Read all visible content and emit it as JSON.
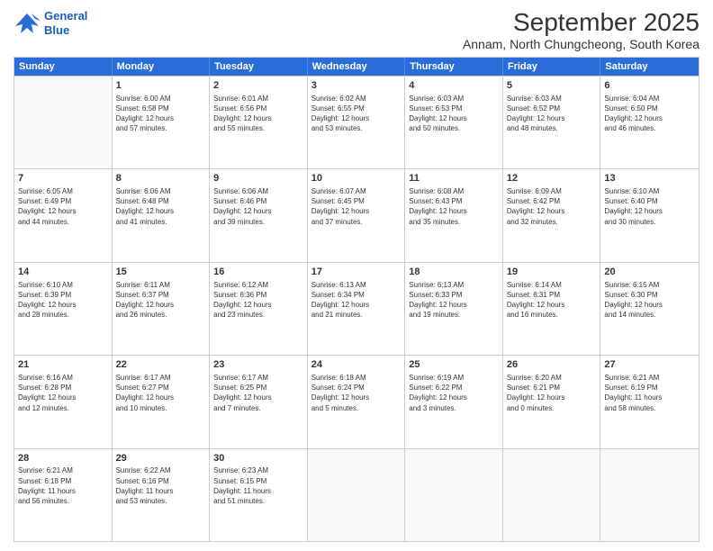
{
  "logo": {
    "line1": "General",
    "line2": "Blue"
  },
  "title": "September 2025",
  "location": "Annam, North Chungcheong, South Korea",
  "days_of_week": [
    "Sunday",
    "Monday",
    "Tuesday",
    "Wednesday",
    "Thursday",
    "Friday",
    "Saturday"
  ],
  "weeks": [
    [
      {
        "day": "",
        "content": ""
      },
      {
        "day": "1",
        "content": "Sunrise: 6:00 AM\nSunset: 6:58 PM\nDaylight: 12 hours\nand 57 minutes."
      },
      {
        "day": "2",
        "content": "Sunrise: 6:01 AM\nSunset: 6:56 PM\nDaylight: 12 hours\nand 55 minutes."
      },
      {
        "day": "3",
        "content": "Sunrise: 6:02 AM\nSunset: 6:55 PM\nDaylight: 12 hours\nand 53 minutes."
      },
      {
        "day": "4",
        "content": "Sunrise: 6:03 AM\nSunset: 6:53 PM\nDaylight: 12 hours\nand 50 minutes."
      },
      {
        "day": "5",
        "content": "Sunrise: 6:03 AM\nSunset: 6:52 PM\nDaylight: 12 hours\nand 48 minutes."
      },
      {
        "day": "6",
        "content": "Sunrise: 6:04 AM\nSunset: 6:50 PM\nDaylight: 12 hours\nand 46 minutes."
      }
    ],
    [
      {
        "day": "7",
        "content": "Sunrise: 6:05 AM\nSunset: 6:49 PM\nDaylight: 12 hours\nand 44 minutes."
      },
      {
        "day": "8",
        "content": "Sunrise: 6:06 AM\nSunset: 6:48 PM\nDaylight: 12 hours\nand 41 minutes."
      },
      {
        "day": "9",
        "content": "Sunrise: 6:06 AM\nSunset: 6:46 PM\nDaylight: 12 hours\nand 39 minutes."
      },
      {
        "day": "10",
        "content": "Sunrise: 6:07 AM\nSunset: 6:45 PM\nDaylight: 12 hours\nand 37 minutes."
      },
      {
        "day": "11",
        "content": "Sunrise: 6:08 AM\nSunset: 6:43 PM\nDaylight: 12 hours\nand 35 minutes."
      },
      {
        "day": "12",
        "content": "Sunrise: 6:09 AM\nSunset: 6:42 PM\nDaylight: 12 hours\nand 32 minutes."
      },
      {
        "day": "13",
        "content": "Sunrise: 6:10 AM\nSunset: 6:40 PM\nDaylight: 12 hours\nand 30 minutes."
      }
    ],
    [
      {
        "day": "14",
        "content": "Sunrise: 6:10 AM\nSunset: 6:39 PM\nDaylight: 12 hours\nand 28 minutes."
      },
      {
        "day": "15",
        "content": "Sunrise: 6:11 AM\nSunset: 6:37 PM\nDaylight: 12 hours\nand 26 minutes."
      },
      {
        "day": "16",
        "content": "Sunrise: 6:12 AM\nSunset: 6:36 PM\nDaylight: 12 hours\nand 23 minutes."
      },
      {
        "day": "17",
        "content": "Sunrise: 6:13 AM\nSunset: 6:34 PM\nDaylight: 12 hours\nand 21 minutes."
      },
      {
        "day": "18",
        "content": "Sunrise: 6:13 AM\nSunset: 6:33 PM\nDaylight: 12 hours\nand 19 minutes."
      },
      {
        "day": "19",
        "content": "Sunrise: 6:14 AM\nSunset: 6:31 PM\nDaylight: 12 hours\nand 16 minutes."
      },
      {
        "day": "20",
        "content": "Sunrise: 6:15 AM\nSunset: 6:30 PM\nDaylight: 12 hours\nand 14 minutes."
      }
    ],
    [
      {
        "day": "21",
        "content": "Sunrise: 6:16 AM\nSunset: 6:28 PM\nDaylight: 12 hours\nand 12 minutes."
      },
      {
        "day": "22",
        "content": "Sunrise: 6:17 AM\nSunset: 6:27 PM\nDaylight: 12 hours\nand 10 minutes."
      },
      {
        "day": "23",
        "content": "Sunrise: 6:17 AM\nSunset: 6:25 PM\nDaylight: 12 hours\nand 7 minutes."
      },
      {
        "day": "24",
        "content": "Sunrise: 6:18 AM\nSunset: 6:24 PM\nDaylight: 12 hours\nand 5 minutes."
      },
      {
        "day": "25",
        "content": "Sunrise: 6:19 AM\nSunset: 6:22 PM\nDaylight: 12 hours\nand 3 minutes."
      },
      {
        "day": "26",
        "content": "Sunrise: 6:20 AM\nSunset: 6:21 PM\nDaylight: 12 hours\nand 0 minutes."
      },
      {
        "day": "27",
        "content": "Sunrise: 6:21 AM\nSunset: 6:19 PM\nDaylight: 11 hours\nand 58 minutes."
      }
    ],
    [
      {
        "day": "28",
        "content": "Sunrise: 6:21 AM\nSunset: 6:18 PM\nDaylight: 11 hours\nand 56 minutes."
      },
      {
        "day": "29",
        "content": "Sunrise: 6:22 AM\nSunset: 6:16 PM\nDaylight: 11 hours\nand 53 minutes."
      },
      {
        "day": "30",
        "content": "Sunrise: 6:23 AM\nSunset: 6:15 PM\nDaylight: 11 hours\nand 51 minutes."
      },
      {
        "day": "",
        "content": ""
      },
      {
        "day": "",
        "content": ""
      },
      {
        "day": "",
        "content": ""
      },
      {
        "day": "",
        "content": ""
      }
    ]
  ]
}
